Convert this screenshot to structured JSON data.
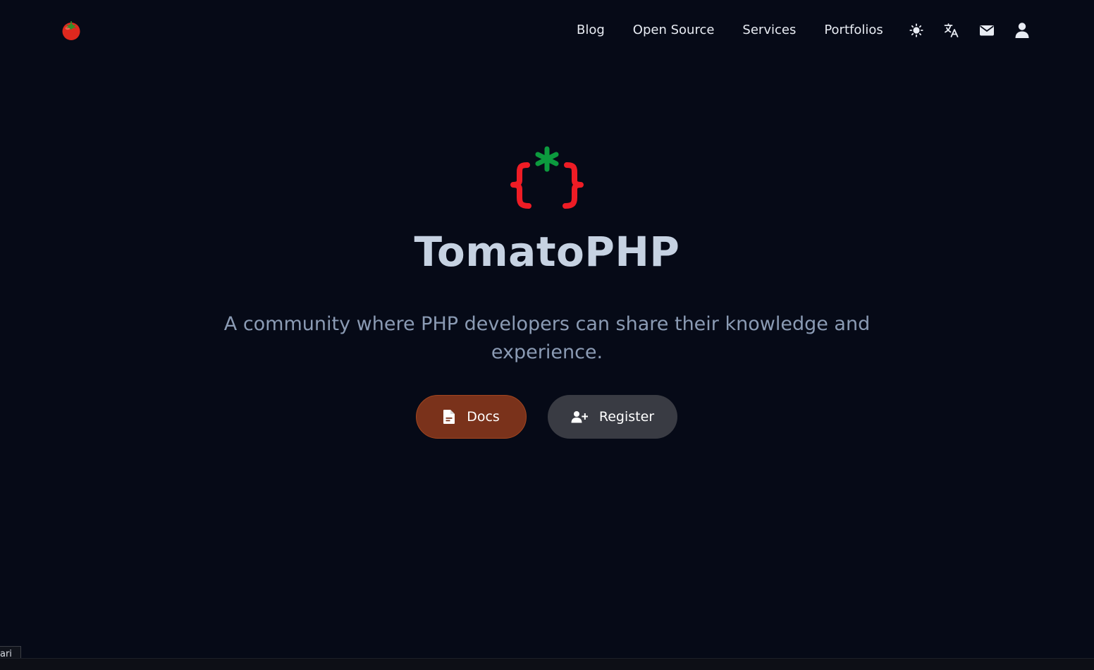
{
  "header": {
    "logo_icon": "tomato-emoji-icon",
    "nav": [
      {
        "label": "Blog"
      },
      {
        "label": "Open Source"
      },
      {
        "label": "Services"
      },
      {
        "label": "Portfolios"
      }
    ],
    "icons": [
      "sun-icon",
      "translate-icon",
      "mail-icon",
      "user-icon"
    ]
  },
  "hero": {
    "logo_icon": "tomato-braces-logo-icon",
    "title": "TomatoPHP",
    "subtitle": "A community where PHP developers can share their knowledge and experience.",
    "buttons": {
      "docs_label": "Docs",
      "docs_icon": "document-icon",
      "register_label": "Register",
      "register_icon": "user-plus-icon"
    }
  },
  "bottom": {
    "tag_text": "ari"
  },
  "colors": {
    "background": "#060a17",
    "title": "#c6d2e2",
    "subtitle": "#8b9bb4",
    "docs_button": "#7a321b",
    "register_button": "#393b43",
    "brace_red": "#ee1c25",
    "asterisk_green": "#0c9a3e"
  }
}
